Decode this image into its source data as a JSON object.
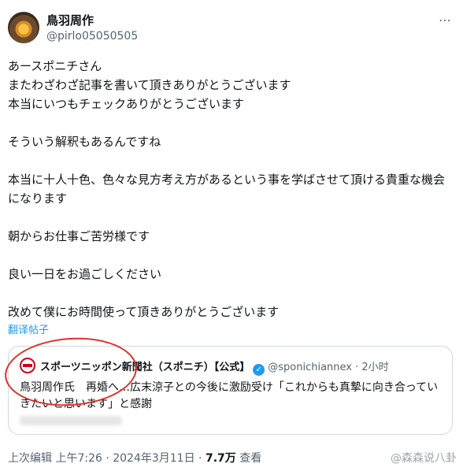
{
  "author": {
    "name": "鳥羽周作",
    "handle": "@pirlo05050505"
  },
  "menu_icon": "⋯",
  "tweet_lines": [
    "あースポニチさん",
    "またわざわざ記事を書いて頂きありがとうございます",
    "本当にいつもチェックありがとうございます",
    "",
    "そういう解釈もあるんですね",
    "",
    "本当に十人十色、色々な見方考え方があるという事を学ばさせて頂ける貴重な機会になります",
    "",
    "朝からお仕事ご苦労様です",
    "",
    "良い一日をお過ごしください",
    "",
    "改めて僕にお時間使って頂きありがとうございます"
  ],
  "translate_label": "翻译帖子",
  "quote": {
    "name": "スポーツニッポン新聞社（スポニチ）【公式】",
    "handle": "@sponichiannex",
    "time": "2小时",
    "text": "鳥羽周作氏　再婚へ…広末涼子との今後に激励受け「これからも真摯に向き合っていきたいと思います」と感謝"
  },
  "footer": {
    "edited": "上次编辑 上午7:26 · 2024年3月11日 ·",
    "views_count": "7.7万",
    "views_label": "查看"
  },
  "watermark": "@森森说八卦",
  "colors": {
    "link": "#1d9bf0",
    "annotation_circle": "#e0302a"
  }
}
